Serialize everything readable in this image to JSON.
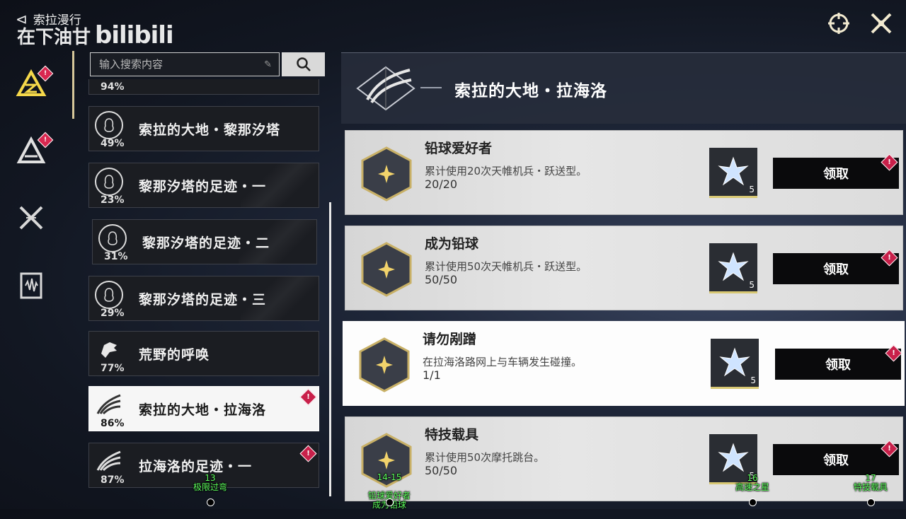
{
  "header": {
    "back_label": "索拉漫行",
    "watermark": "在下油甘",
    "watermark_logo": "bilibili",
    "icons": [
      "target-icon",
      "close-icon"
    ]
  },
  "rail": {
    "items": [
      {
        "icon": "emblem-triangle-icon",
        "badge": "!"
      },
      {
        "icon": "mountain-a-icon",
        "badge": "!"
      },
      {
        "icon": "crossed-blades-icon",
        "badge": ""
      },
      {
        "icon": "audio-book-icon",
        "badge": ""
      }
    ]
  },
  "search": {
    "placeholder": "输入搜索内容"
  },
  "categories": [
    {
      "name": "",
      "pct": "94%"
    },
    {
      "name": "索拉的大地・黎那汐塔",
      "pct": "49%"
    },
    {
      "name": "黎那汐塔的足迹・一",
      "pct": "23%"
    },
    {
      "name": "黎那汐塔的足迹・二",
      "pct": "31%"
    },
    {
      "name": "黎那汐塔的足迹・三",
      "pct": "29%"
    },
    {
      "name": "荒野的呼唤",
      "pct": "77%"
    },
    {
      "name": "索拉的大地・拉海洛",
      "pct": "86%",
      "badge": "!"
    },
    {
      "name": "拉海洛的足迹・一",
      "pct": "87%",
      "badge": "!"
    }
  ],
  "panel": {
    "title": "索拉的大地・拉海洛"
  },
  "achievements": [
    {
      "title": "铅球爱好者",
      "desc": "累计使用20次天帷机兵・跃送型。",
      "progress": "20/20",
      "reward_qty": "5",
      "claim": "领取",
      "badge": "!"
    },
    {
      "title": "成为铅球",
      "desc": "累计使用50次天帷机兵・跃送型。",
      "progress": "50/50",
      "reward_qty": "5",
      "claim": "领取",
      "badge": "!"
    },
    {
      "title": "请勿剐蹭",
      "desc": "在拉海洛路网上与车辆发生碰撞。",
      "progress": "1/1",
      "reward_qty": "5",
      "claim": "领取",
      "badge": "!"
    },
    {
      "title": "特技载具",
      "desc": "累计使用50次摩托跳台。",
      "progress": "50/50",
      "reward_qty": "5",
      "claim": "领取",
      "badge": "!"
    }
  ],
  "timeline": [
    {
      "num": "13",
      "label": "极限过弯"
    },
    {
      "num": "14-15",
      "label": "铅球爱好者\n成为铅球"
    },
    {
      "num": "16",
      "label": "高速之星"
    },
    {
      "num": "17",
      "label": "特技载具"
    }
  ],
  "colors": {
    "accent_gold": "#d8c873",
    "badge_red": "#c8204a",
    "timeline_green": "#5dff5d"
  }
}
